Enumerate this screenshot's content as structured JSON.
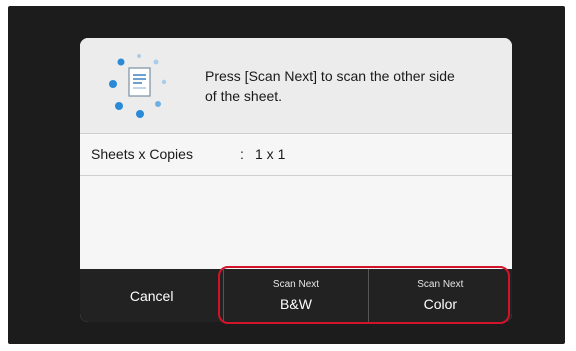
{
  "dialog": {
    "message_line1": "Press [Scan Next] to scan the other side",
    "message_line2": "of the sheet.",
    "icon": "scan-document-icon"
  },
  "info": {
    "label": "Sheets x Copies",
    "separator": ":",
    "value": "1 x 1"
  },
  "buttons": {
    "cancel": "Cancel",
    "scan_bw_top": "Scan Next",
    "scan_bw_bottom": "B&W",
    "scan_color_top": "Scan Next",
    "scan_color_bottom": "Color"
  },
  "colors": {
    "highlight": "#d2142a",
    "icon_blue": "#2a8ad8"
  }
}
